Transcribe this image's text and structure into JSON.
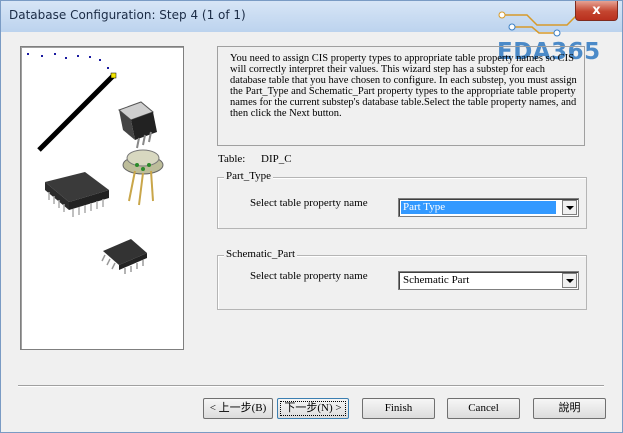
{
  "window": {
    "title": "Database Configuration: Step 4 (1 of 1)",
    "close_glyph": "x"
  },
  "watermark": {
    "text": "EDA365"
  },
  "info": {
    "text": "You need to assign CIS property types to appropriate table property names so CIS will correctly interpret their values. This wizard step has a substep for each database table that you have chosen to configure. In each substep, you must assign the Part_Type and Schematic_Part property types to the appropriate table property names for the current substep's database table.Select the table property names, and then click the Next button."
  },
  "table": {
    "label": "Table:",
    "value": "DIP_C"
  },
  "part_type": {
    "legend": "Part_Type",
    "field_label": "Select table property name",
    "selected": "Part Type"
  },
  "schematic_part": {
    "legend": "Schematic_Part",
    "field_label": "Select table property name",
    "selected": "Schematic Part"
  },
  "buttons": {
    "back": "< 上一步(B)",
    "next": "下一步(N) >",
    "finish": "Finish",
    "cancel": "Cancel",
    "help": "說明"
  }
}
